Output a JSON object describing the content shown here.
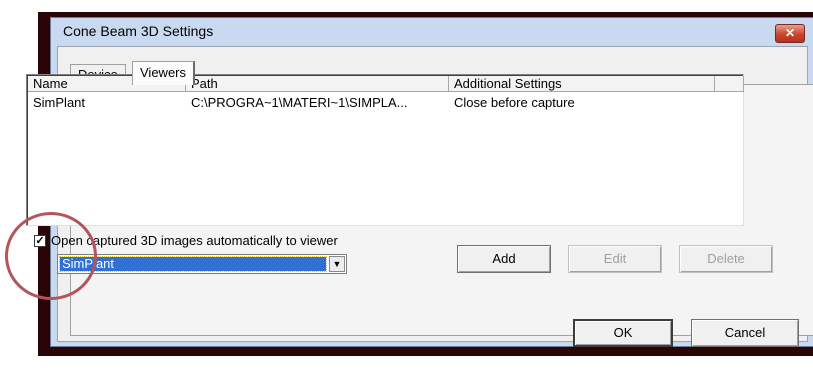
{
  "window": {
    "title": "Cone Beam 3D Settings",
    "close_glyph": "✕"
  },
  "tabs": [
    {
      "label": "Device",
      "active": false
    },
    {
      "label": "Viewers",
      "active": true
    }
  ],
  "viewers_list": {
    "columns": [
      "Name",
      "Path",
      "Additional Settings"
    ],
    "rows": [
      {
        "name": "SimPlant",
        "path": "C:\\PROGRA~1\\MATERI~1\\SIMPLA...",
        "settings": "Close before capture"
      }
    ]
  },
  "auto_open": {
    "checked": true,
    "check_glyph": "✓",
    "label": "Open captured 3D images automatically to viewer"
  },
  "viewer_select": {
    "value": "SimPlant",
    "arrow_glyph": "▼"
  },
  "buttons": {
    "add": "Add",
    "edit": "Edit",
    "delete": "Delete",
    "ok": "OK",
    "cancel": "Cancel"
  },
  "colors": {
    "annotation_circle": "#b4555a",
    "selection": "#2f6fd6",
    "close_button": "#c9452c"
  }
}
